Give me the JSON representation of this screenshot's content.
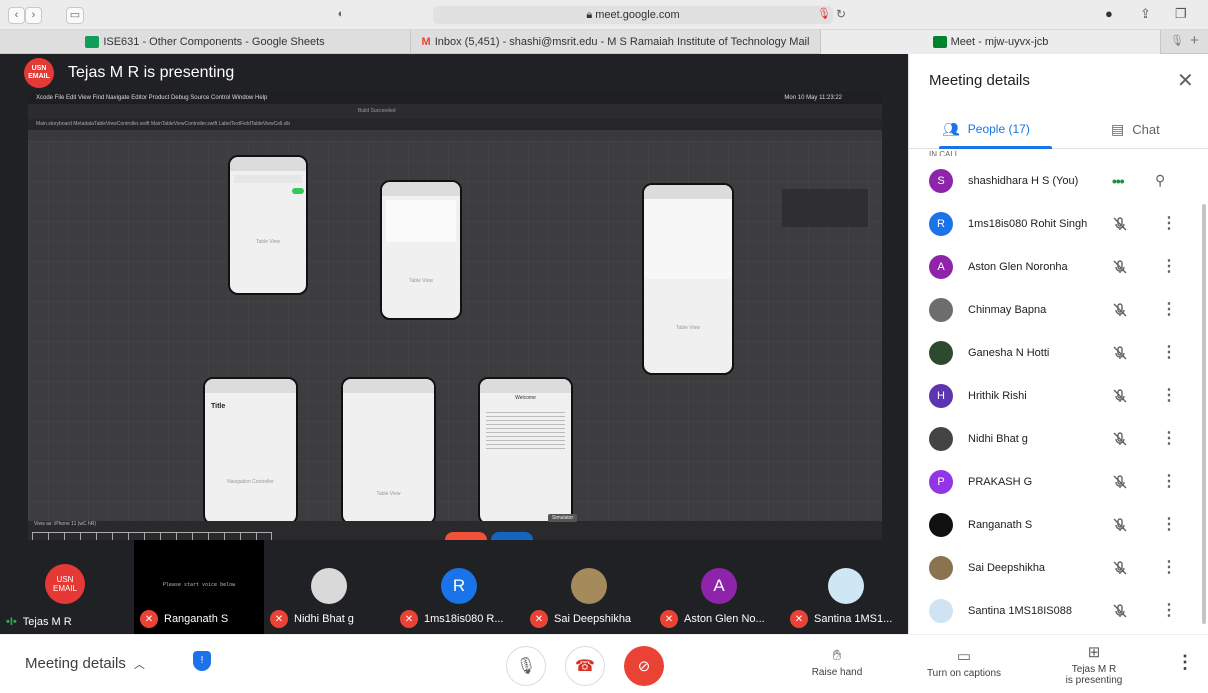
{
  "browser": {
    "address": "meet.google.com",
    "tabs": [
      {
        "label": "ISE631 - Other Components - Google Sheets",
        "color": "#0f9d58"
      },
      {
        "label": "Inbox (5,451) - shashi@msrit.edu - M S Ramaiah Institute of Technology Mail",
        "color": "#ea4335"
      },
      {
        "label": "Meet - mjw-uyvx-jcb",
        "color": "#00832d"
      }
    ]
  },
  "stage": {
    "presenter_badge": [
      "USN",
      "EMAIL"
    ],
    "presenter_title": "Tejas M R is presenting",
    "shared_screen": {
      "menu": "Xcode  File  Edit  View  Find  Navigate  Editor  Product  Debug  Source Control  Window  Help",
      "clock": "Mon 10 May 11:23:22",
      "status": "Build Succeeded",
      "tab_files": "Main.storyboard    MetadataTableViewController.swift    MainTableViewController.swift    LabelTextFieldTableViewCell.xib",
      "phone_labels": [
        "Table View",
        "Table View",
        "Table View",
        "Title",
        "Navigation Controller",
        "Table View",
        "Welcome"
      ],
      "tooltip": "Simulator",
      "view_as": "View as: iPhone 11 (wC hR)"
    }
  },
  "tiles": [
    {
      "name": "Tejas M R",
      "badge": [
        "USN",
        "EMAIL"
      ],
      "speaking": true,
      "avatar_color": "#e53935"
    },
    {
      "name": "Ranganath S",
      "caption": "Please start voice below",
      "avatar_color": "#000000"
    },
    {
      "name": "Nidhi Bhat g",
      "avatar_color": "#d9d9d9"
    },
    {
      "name": "1ms18is080 R...",
      "initial": "R",
      "avatar_color": "#1a73e8"
    },
    {
      "name": "Sai Deepshikha",
      "avatar_color": "#a58a5c"
    },
    {
      "name": "Aston Glen No...",
      "initial": "A",
      "avatar_color": "#8e24aa"
    },
    {
      "name": "Santina 1MS1...",
      "avatar_color": "#cfe7f5"
    }
  ],
  "panel": {
    "title": "Meeting details",
    "tab_people": "People (17)",
    "tab_chat": "Chat",
    "section_cut": "IN CALL",
    "people": [
      {
        "name": "shashidhara H S (You)",
        "initial": "S",
        "color": "#8e24aa",
        "self": true
      },
      {
        "name": "1ms18is080 Rohit Singh",
        "initial": "R",
        "color": "#1a73e8"
      },
      {
        "name": "Aston Glen Noronha",
        "initial": "A",
        "color": "#8e24aa"
      },
      {
        "name": "Chinmay Bapna",
        "initial": "",
        "color": "#6d6d6d"
      },
      {
        "name": "Ganesha N Hotti",
        "initial": "",
        "color": "#2e4a2e"
      },
      {
        "name": "Hrithik Rishi",
        "initial": "H",
        "color": "#5e35b1"
      },
      {
        "name": "Nidhi Bhat g",
        "initial": "",
        "color": "#444444"
      },
      {
        "name": "PRAKASH G",
        "initial": "P",
        "color": "#9334e6"
      },
      {
        "name": "Ranganath S",
        "initial": "",
        "color": "#111111"
      },
      {
        "name": "Sai Deepshikha",
        "initial": "",
        "color": "#8a7350"
      },
      {
        "name": "Santina 1MS18IS088",
        "initial": "",
        "color": "#cfe3f2"
      }
    ]
  },
  "footer": {
    "meeting_details": "Meeting details",
    "raise_hand": "Raise hand",
    "captions": "Turn on captions",
    "presenting": "Tejas M R",
    "presenting2": "is presenting"
  }
}
